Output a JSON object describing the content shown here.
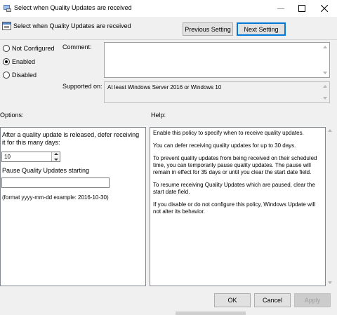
{
  "window": {
    "title": "Select when Quality Updates are received"
  },
  "header": {
    "title": "Select when Quality Updates are received",
    "previous_setting": "Previous Setting",
    "next_setting": "Next Setting"
  },
  "state": {
    "options": [
      {
        "label": "Not Configured",
        "checked": false
      },
      {
        "label": "Enabled",
        "checked": true
      },
      {
        "label": "Disabled",
        "checked": false
      }
    ],
    "comment_label": "Comment:",
    "comment_value": "",
    "supported_label": "Supported on:",
    "supported_value": "At least Windows Server 2016 or Windows 10"
  },
  "options_panel": {
    "heading": "Options:",
    "defer_label": "After a quality update is released, defer receiving it for this many days:",
    "defer_value": "10",
    "pause_label": "Pause Quality Updates starting",
    "pause_value": "",
    "format_hint": "(format yyyy-mm-dd example: 2016-10-30)"
  },
  "help_panel": {
    "heading": "Help:",
    "paragraphs": [
      "Enable this policy to specify when to receive quality updates.",
      "You can defer receiving quality updates for up to 30 days.",
      "To prevent quality updates from being received on their scheduled time, you can temporarily pause quality updates. The pause will remain in effect for 35 days or until you clear the start date field.",
      "To resume receiving Quality Updates which are paused, clear the start date field.",
      "If you disable or do not configure this policy, Windows Update will not alter its behavior."
    ]
  },
  "footer": {
    "ok": "OK",
    "cancel": "Cancel",
    "apply": "Apply"
  },
  "colors": {
    "focus_border": "#0078d7",
    "window_bg": "#f0f0f0"
  },
  "icons": {
    "title": "group-policy-icon",
    "header": "policy-setting-icon"
  }
}
